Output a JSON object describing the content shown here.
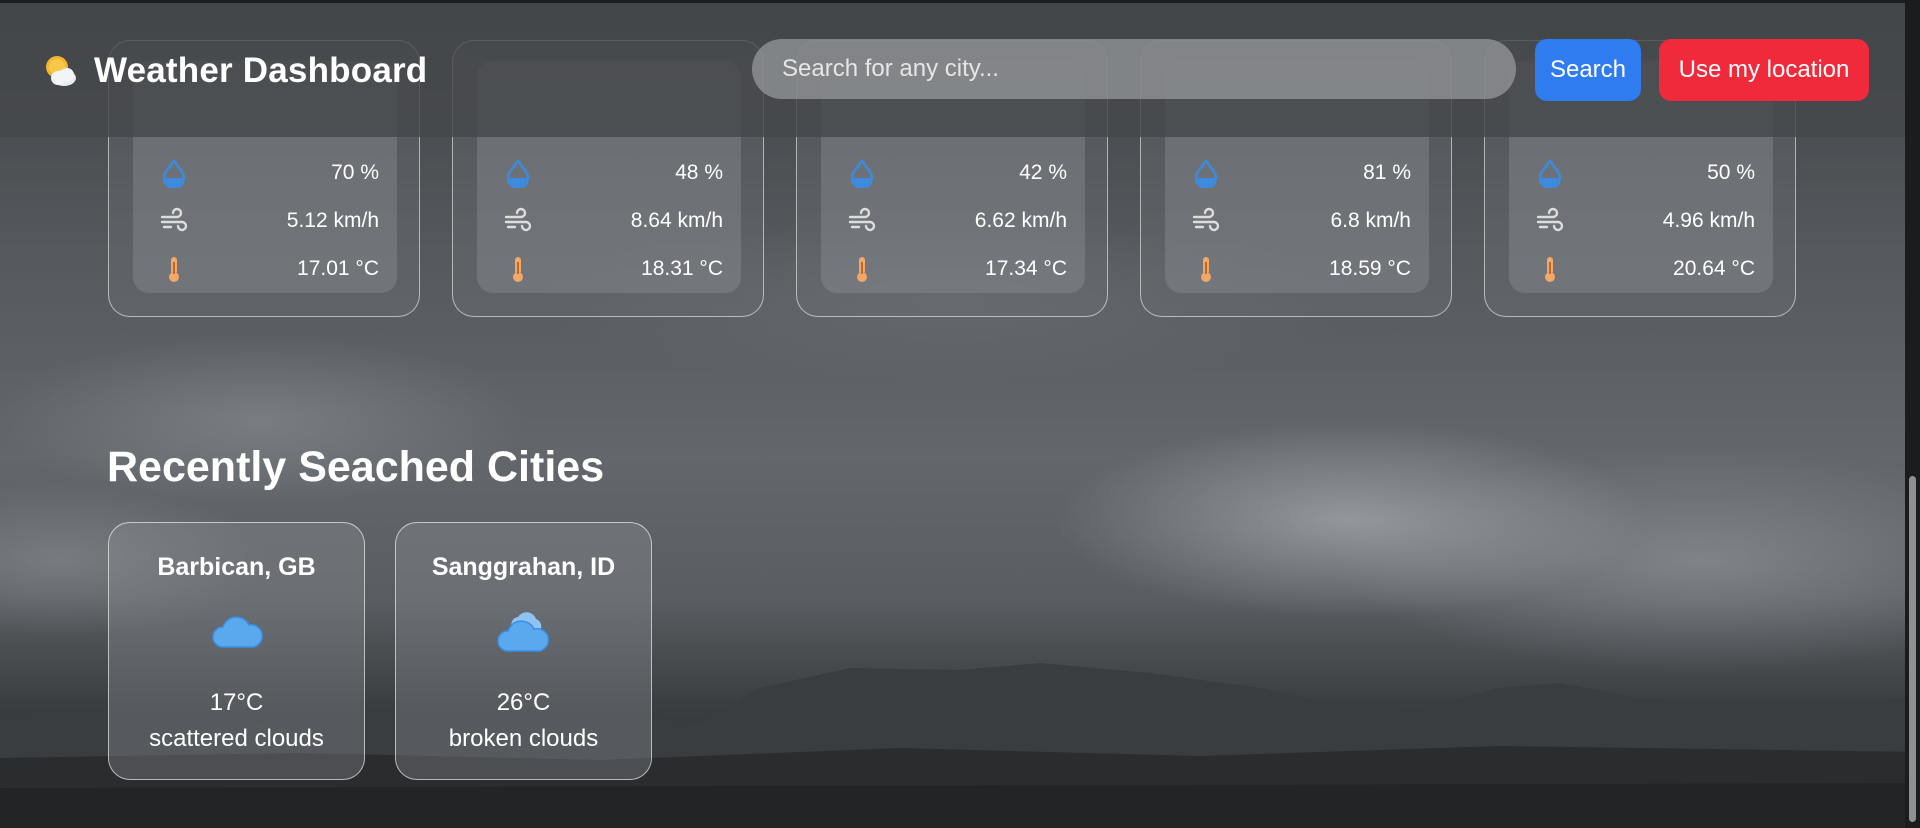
{
  "app": {
    "title": "Weather Dashboard",
    "icon": "sun-behind-cloud-icon"
  },
  "search": {
    "placeholder": "Search for any city...",
    "value": ""
  },
  "buttons": {
    "search_label": "Search",
    "location_label": "Use my location"
  },
  "forecast": [
    {
      "humidity": "70 %",
      "wind": "5.12 km/h",
      "temp": "17.01 °C"
    },
    {
      "humidity": "48 %",
      "wind": "8.64 km/h",
      "temp": "18.31 °C"
    },
    {
      "humidity": "42 %",
      "wind": "6.62 km/h",
      "temp": "17.34 °C"
    },
    {
      "humidity": "81 %",
      "wind": "6.8 km/h",
      "temp": "18.59 °C"
    },
    {
      "humidity": "50 %",
      "wind": "4.96 km/h",
      "temp": "20.64 °C"
    }
  ],
  "recent": {
    "title": "Recently Seached Cities",
    "cities": [
      {
        "name": "Barbican, GB",
        "temp": "17°C",
        "description": "scattered clouds",
        "icon": "cloud-icon"
      },
      {
        "name": "Sanggrahan, ID",
        "temp": "26°C",
        "description": "broken clouds",
        "icon": "broken-clouds-icon"
      }
    ]
  },
  "colors": {
    "search_button": "#2f7bf0",
    "location_button": "#f0293b",
    "humidity_icon": "#3d8be0",
    "thermometer_icon": "#f0a868",
    "cloud_icon": "#5aa8ee"
  }
}
